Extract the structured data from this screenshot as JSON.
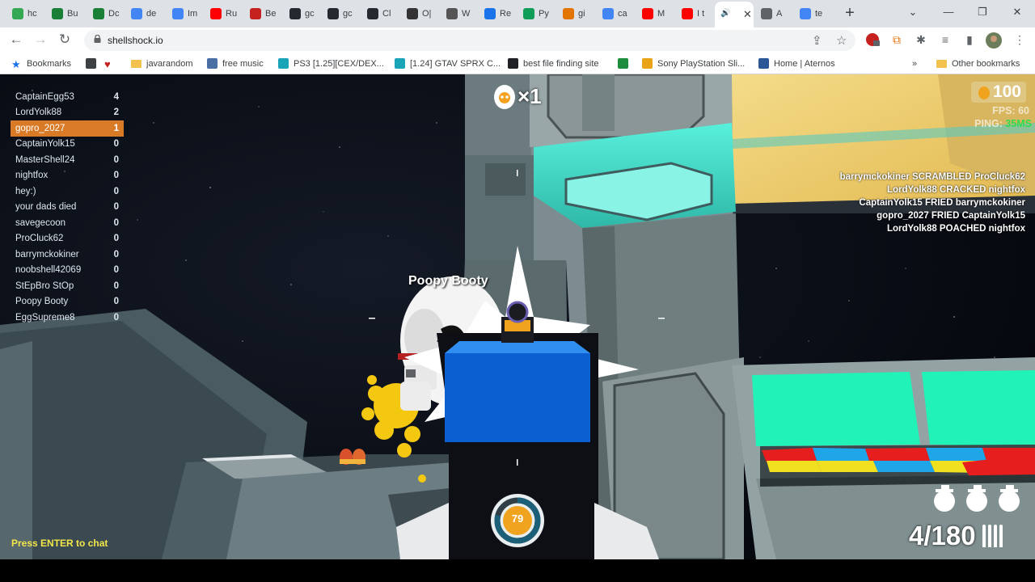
{
  "browser": {
    "tabs": [
      {
        "label": "hc",
        "color": "#34a853"
      },
      {
        "label": "Bu",
        "color": "#1a7f37"
      },
      {
        "label": "Dc",
        "color": "#1a7f37"
      },
      {
        "label": "de",
        "color": "#4285f4"
      },
      {
        "label": "Im",
        "color": "#4285f4"
      },
      {
        "label": "Ru",
        "color": "#ff0000"
      },
      {
        "label": "Be",
        "color": "#c5221f"
      },
      {
        "label": "gc",
        "color": "#24292f"
      },
      {
        "label": "gc",
        "color": "#24292f"
      },
      {
        "label": "Cl",
        "color": "#24292f"
      },
      {
        "label": "O|",
        "color": "#333333"
      },
      {
        "label": "W",
        "color": "#555555"
      },
      {
        "label": "Re",
        "color": "#1a73e8"
      },
      {
        "label": "Py",
        "color": "#0f9d58"
      },
      {
        "label": "gi",
        "color": "#e37400"
      },
      {
        "label": "ca",
        "color": "#4285f4"
      },
      {
        "label": "M",
        "color": "#ff0000"
      },
      {
        "label": "I t",
        "color": "#ff0000"
      },
      {
        "label": "",
        "color": "#3c4043",
        "active": true
      },
      {
        "label": "A",
        "color": "#5f6368"
      },
      {
        "label": "te",
        "color": "#4285f4"
      }
    ],
    "url": "shellshock.io",
    "bookmarks": [
      {
        "label": "Bookmarks",
        "color": "#1a73e8"
      },
      {
        "label": "",
        "color": "#3c4043"
      },
      {
        "label": "",
        "color": "#c5221f"
      },
      {
        "label": "javarandom",
        "color": "#f2c14e",
        "folder": true
      },
      {
        "label": "free music",
        "color": "#4a6fa5"
      },
      {
        "label": "PS3 [1.25][CEX/DEX...",
        "color": "#1aa4b8"
      },
      {
        "label": "[1.24] GTAV SPRX C...",
        "color": "#1aa4b8"
      },
      {
        "label": "best file finding site",
        "color": "#202124"
      },
      {
        "label": "",
        "color": "#1e8e3e"
      },
      {
        "label": "Sony PlayStation Sli...",
        "color": "#e8a317"
      },
      {
        "label": "Home | Aternos",
        "color": "#2b5797"
      }
    ],
    "other_bookmarks": "Other bookmarks"
  },
  "game": {
    "scoreboard": [
      {
        "name": "CaptainEgg53",
        "score": "4"
      },
      {
        "name": "LordYolk88",
        "score": "2"
      },
      {
        "name": "gopro_2027",
        "score": "1",
        "me": true
      },
      {
        "name": "CaptainYolk15",
        "score": "0"
      },
      {
        "name": "MasterShell24",
        "score": "0"
      },
      {
        "name": "nightfox",
        "score": "0"
      },
      {
        "name": "hey:)",
        "score": "0"
      },
      {
        "name": "your dads died",
        "score": "0"
      },
      {
        "name": "savegecoon",
        "score": "0"
      },
      {
        "name": "ProCluck62",
        "score": "0"
      },
      {
        "name": "barrymckokiner",
        "score": "0"
      },
      {
        "name": "noobshell42069",
        "score": "0"
      },
      {
        "name": "StEpBro StOp",
        "score": "0"
      },
      {
        "name": "Poopy Booty",
        "score": "0"
      },
      {
        "name": "EggSupreme8",
        "score": "0"
      }
    ],
    "killstreak": "×1",
    "eggs": "100",
    "fps": "FPS: 60",
    "ping_label": "PING: ",
    "ping_value": "35MS",
    "killfeed": [
      "barrymckokiner SCRAMBLED ProCluck62",
      "LordYolk88 CRACKED nightfox",
      "CaptainYolk15 FRIED barrymckokiner",
      "gopro_2027 FRIED CaptainYolk15",
      "LordYolk88 POACHED nightfox"
    ],
    "enemy_nametag": "Poopy Booty",
    "chat_hint": "Press ENTER to chat",
    "health": "79",
    "health_fraction": 0.79,
    "grenades": 3,
    "ammo": "4/180",
    "colors": {
      "accent": "#d97a26",
      "ping_green": "#2fdc4f",
      "chat_yellow": "#f2e64a",
      "gun_blue": "#0b5fd0"
    }
  }
}
